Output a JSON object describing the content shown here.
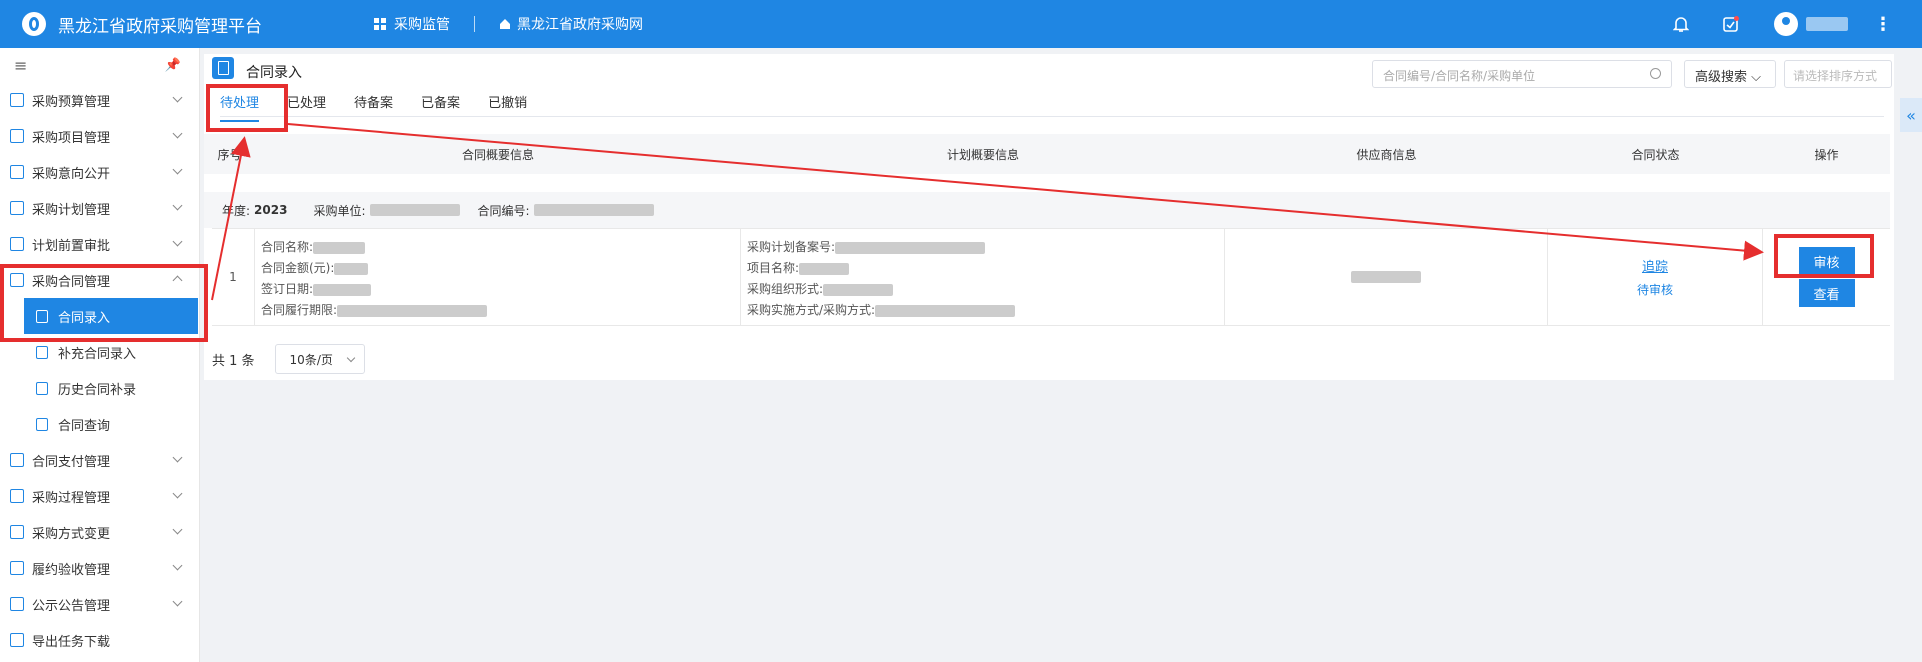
{
  "app": {
    "title": "黑龙江省政府采购管理平台"
  },
  "topnav": {
    "monitor": "采购监管",
    "site": "黑龙江省政府采购网"
  },
  "sidebar": {
    "items": [
      {
        "label": "采购预算管理"
      },
      {
        "label": "采购项目管理"
      },
      {
        "label": "采购意向公开"
      },
      {
        "label": "采购计划管理"
      },
      {
        "label": "计划前置审批"
      },
      {
        "label": "采购合同管理"
      },
      {
        "label": "合同支付管理"
      },
      {
        "label": "采购过程管理"
      },
      {
        "label": "采购方式变更"
      },
      {
        "label": "履约验收管理"
      },
      {
        "label": "公示公告管理"
      },
      {
        "label": "导出任务下载"
      }
    ],
    "subitems": [
      {
        "label": "合同录入"
      },
      {
        "label": "补充合同录入"
      },
      {
        "label": "历史合同补录"
      },
      {
        "label": "合同查询"
      }
    ]
  },
  "page": {
    "title": "合同录入",
    "search_placeholder": "合同编号/合同名称/采购单位",
    "advanced": "高级搜索",
    "sort_placeholder": "请选择排序方式",
    "tabs": [
      "待处理",
      "已处理",
      "待备案",
      "已备案",
      "已撤销"
    ]
  },
  "table": {
    "headers": [
      "序号",
      "合同概要信息",
      "计划概要信息",
      "供应商信息",
      "合同状态",
      "操作"
    ],
    "year_label": "年度:",
    "year_value": "2023",
    "unit_label": "采购单位:",
    "code_label": "合同编号:",
    "row": {
      "index": "1",
      "contract": [
        "合同名称:",
        "合同金额(元):",
        "签订日期:",
        "合同履行期限:"
      ],
      "plan": [
        "采购计划备案号:",
        "项目名称:",
        "采购组织形式:",
        "采购实施方式/采购方式:"
      ],
      "track": "追踪",
      "status": "待审核",
      "btn_review": "审核",
      "btn_view": "查看"
    }
  },
  "pager": {
    "total": "共 1 条",
    "page_size": "10条/页"
  },
  "colors": {
    "primary": "#1f86e3",
    "highlight": "#e52e2e"
  }
}
